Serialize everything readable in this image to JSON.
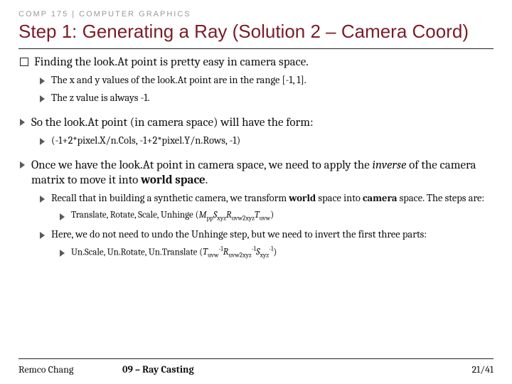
{
  "course_tag": "COMP 175 | COMPUTER GRAPHICS",
  "title": "Step 1: Generating a Ray (Solution 2 – Camera Coord)",
  "bullets": {
    "b1": "Finding the look.At point is pretty easy in camera space.",
    "b1a": "The x and y values of the look.At point are in the range [-1, 1].",
    "b1b": "The z value is always -1.",
    "b2": "So the look.At point (in camera space) will have the form:",
    "b2a": "(-1+2*pixel.X/n.Cols, -1+2*pixel.Y/n.Rows, -1)",
    "b3_pre": "Once we have the look.At point in camera space, we need to apply the ",
    "b3_em": "inverse",
    "b3_mid": " of the camera matrix to move it into ",
    "b3_bold": "world space",
    "b3_post": ".",
    "b3a_pre": "Recall that in building a synthetic camera, we transform ",
    "b3a_b1": "world",
    "b3a_mid": " space into ",
    "b3a_b2": "camera",
    "b3a_post": " space.  The steps are:",
    "b3a1_pre": "Translate, Rotate, Scale, Unhinge (",
    "b3a1_math_html": "<i>M</i><sub>pp</sub><i>S</i><sub>xyz</sub><i>R</i><sub>uvw2xyz</sub><i>T</i><sub>uvw</sub>",
    "b3a1_post": ")",
    "b3b": "Here, we do not need to undo the Unhinge step, but we need to invert the first three parts:",
    "b3b1_pre": "Un.Scale, Un.Rotate, Un.Translate (",
    "b3b1_math_html": "<i>T</i><sub>uvw</sub><sup>-1</sup><i>R</i><sub>uvw2xyz</sub><sup>-1</sup><i>S</i><sub>xyz</sub><sup>-1</sup>",
    "b3b1_post": ")"
  },
  "footer": {
    "author": "Remco Chang",
    "chapter": "09 – Ray Casting",
    "page": "21/41"
  }
}
